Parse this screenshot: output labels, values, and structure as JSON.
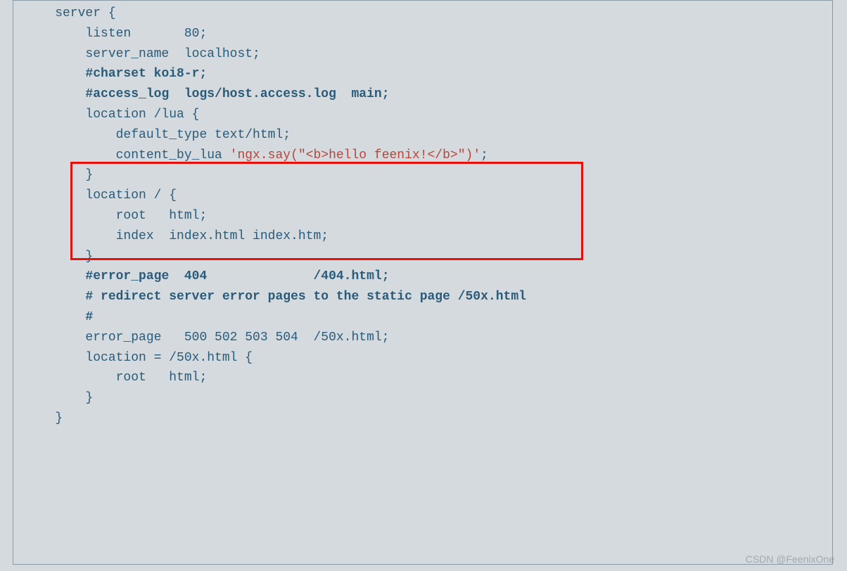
{
  "lines": {
    "l1": "    server {",
    "l2": "        listen       80;",
    "l3": "        server_name  localhost;",
    "l4": "",
    "l5a": "        ",
    "l5b": "#charset koi8-r;",
    "l6": "",
    "l7a": "        ",
    "l7b": "#access_log  logs/host.access.log  main;",
    "l8": "",
    "l9": "        location /lua {",
    "l10": "            default_type text/html;",
    "l11a": "            content_by_lua ",
    "l11b": "'ngx.say(\"<b>hello feenix!</b>\")'",
    "l11c": ";",
    "l12": "        }",
    "l13": "",
    "l14": "        location / {",
    "l15": "            root   html;",
    "l16": "            index  index.html index.htm;",
    "l17": "        }",
    "l18": "",
    "l19a": "        ",
    "l19b": "#error_page  404              /404.html;",
    "l20": "",
    "l21a": "        ",
    "l21b": "# redirect server error pages to the static page /50x.html",
    "l22a": "        ",
    "l22b": "#",
    "l23": "        error_page   500 502 503 504  /50x.html;",
    "l24": "        location = /50x.html {",
    "l25": "            root   html;",
    "l26": "        }",
    "l27": "    }"
  },
  "watermark": "CSDN @FeenixOne"
}
